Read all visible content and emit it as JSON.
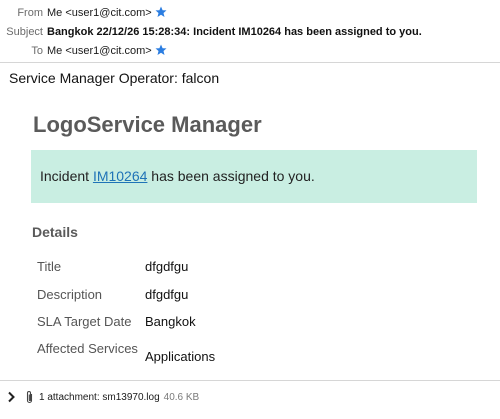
{
  "header": {
    "from_label": "From",
    "from_value": "Me <user1@cit.com>",
    "subject_label": "Subject",
    "subject_value": "Bangkok 22/12/26 15:28:34: Incident IM10264 has been assigned to you.",
    "to_label": "To",
    "to_value": "Me <user1@cit.com>",
    "star_icon": "star-icon",
    "star_color": "#2b7de1"
  },
  "email": {
    "operator_line": "Service Manager Operator: falcon",
    "brand": "LogoService Manager",
    "banner": {
      "prefix": "Incident ",
      "link": "IM10264",
      "suffix": " has been assigned to you.",
      "bg_color": "#c9eee2",
      "link_color": "#1f73b7"
    },
    "details_heading": "Details",
    "details": [
      {
        "label": "Title",
        "value": "dfgdfgu"
      },
      {
        "label": "Description",
        "value": "dfgdfgu"
      },
      {
        "label": "SLA Target Date",
        "value": "Bangkok"
      },
      {
        "label": "Affected Services",
        "value": "Applications"
      }
    ]
  },
  "attachments": {
    "chevron_icon": "chevron-right-icon",
    "clip_icon": "paperclip-icon",
    "summary": "1 attachment: sm13970.log",
    "size": "40.6 KB"
  }
}
